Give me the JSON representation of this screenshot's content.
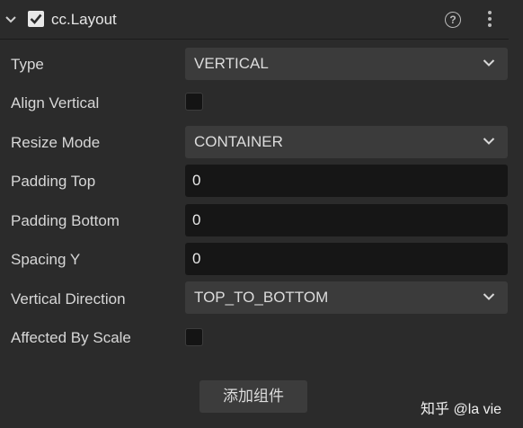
{
  "component": {
    "title": "cc.Layout",
    "enabled": true
  },
  "icons": {
    "collapse": "chevron-down-icon",
    "enabled": "checkbox-checked-icon",
    "help": "help-icon",
    "more": "more-vertical-icon",
    "dropdown": "chevron-down-icon"
  },
  "properties": {
    "type": {
      "label": "Type",
      "value": "VERTICAL"
    },
    "align_vertical": {
      "label": "Align Vertical",
      "checked": false
    },
    "resize_mode": {
      "label": "Resize Mode",
      "value": "CONTAINER"
    },
    "padding_top": {
      "label": "Padding Top",
      "value": "0"
    },
    "padding_bottom": {
      "label": "Padding Bottom",
      "value": "0"
    },
    "spacing_y": {
      "label": "Spacing Y",
      "value": "0"
    },
    "vertical_direction": {
      "label": "Vertical Direction",
      "value": "TOP_TO_BOTTOM"
    },
    "affected_by_scale": {
      "label": "Affected By Scale",
      "checked": false
    }
  },
  "add_component_label": "添加组件",
  "help_glyph": "?",
  "watermark": "知乎 @la vie",
  "colors": {
    "background": "#2b2b2b",
    "select_bg": "#3b3b3b",
    "input_bg": "#161616",
    "text": "#d7d7d7"
  }
}
